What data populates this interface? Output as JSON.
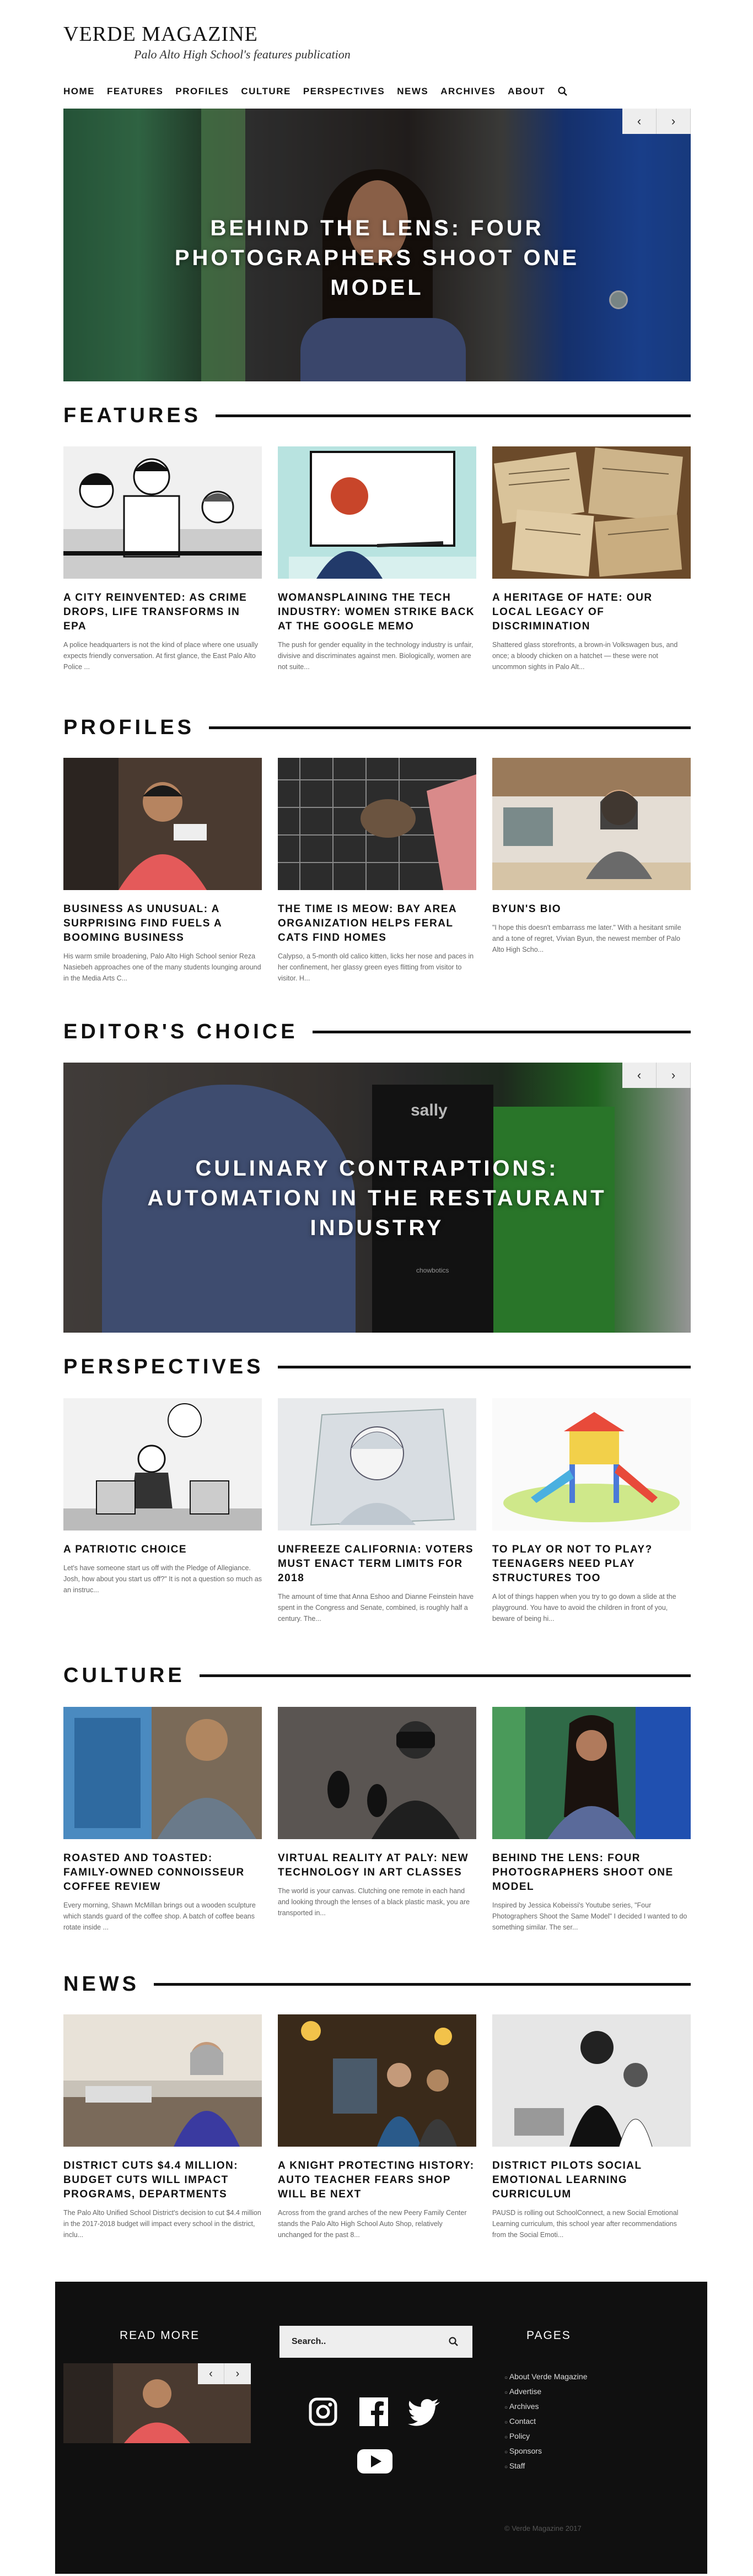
{
  "site": {
    "title": "VERDE MAGAZINE",
    "subtitle": "Palo Alto High School's features publication"
  },
  "nav": [
    "HOME",
    "FEATURES",
    "PROFILES",
    "CULTURE",
    "PERSPECTIVES",
    "NEWS",
    "ARCHIVES",
    "ABOUT"
  ],
  "hero": {
    "title": "BEHIND THE LENS: FOUR PHOTOGRAPHERS SHOOT ONE MODEL",
    "prev": "‹",
    "next": "›"
  },
  "sections": {
    "features": {
      "heading": "FEATURES",
      "cards": [
        {
          "title": "A CITY REINVENTED: AS CRIME DROPS, LIFE TRANSFORMS IN EPA",
          "excerpt": "A police headquarters is not the kind of place where one usually expects friendly conversation. At first glance, the East Palo Alto Police ..."
        },
        {
          "title": "WOMANSPLAINING THE TECH INDUSTRY: WOMEN STRIKE BACK AT THE GOOGLE MEMO",
          "excerpt": "The push for gender equality in the technology industry is unfair, divisive and discriminates against men. Biologically, women are not suite..."
        },
        {
          "title": "A HERITAGE OF HATE: OUR LOCAL LEGACY OF DISCRIMINATION",
          "excerpt": "Shattered glass storefronts, a brown-in Volkswagen bus, and once; a bloody chicken on a hatchet — these were not uncommon sights in Palo Alt..."
        }
      ]
    },
    "profiles": {
      "heading": "PROFILES",
      "cards": [
        {
          "title": "BUSINESS AS UNUSUAL: A SURPRISING FIND FUELS A BOOMING BUSINESS",
          "excerpt": "His warm smile broadening, Palo Alto High School senior Reza Nasiebeh approaches one of the many students lounging around in the Media Arts C..."
        },
        {
          "title": "THE TIME IS MEOW: BAY AREA ORGANIZATION HELPS FERAL CATS FIND HOMES",
          "excerpt": "Calypso, a 5-month old calico kitten, licks her nose and paces in her confinement, her glassy green eyes flitting from visitor to visitor. H..."
        },
        {
          "title": "BYUN'S BIO",
          "excerpt": "\"I hope this doesn't embarrass me later.\" With a hesitant smile and a tone of regret, Vivian Byun, the newest member of Palo Alto High Scho..."
        }
      ]
    },
    "editors": {
      "heading": "EDITOR'S CHOICE",
      "slide_title": "CULINARY CONTRAPTIONS: AUTOMATION IN THE RESTAURANT INDUSTRY",
      "sign": "sally",
      "sign2": "chowbotics"
    },
    "perspectives": {
      "heading": "PERSPECTIVES",
      "cards": [
        {
          "title": "A PATRIOTIC CHOICE",
          "excerpt": "Let's have someone start us off with the Pledge of Allegiance. Josh, how about you start us off?\" It is not a question so much as an instruc..."
        },
        {
          "title": "UNFREEZE CALIFORNIA: VOTERS MUST ENACT TERM LIMITS FOR 2018",
          "excerpt": "The amount of time that Anna Eshoo and Dianne Feinstein have spent in the Congress and Senate, combined, is roughly half a century. The..."
        },
        {
          "title": "TO PLAY OR NOT TO PLAY? TEENAGERS NEED PLAY STRUCTURES TOO",
          "excerpt": "A lot of things happen when you try to go down a slide at the playground. You have to avoid the children in front of you, beware of being hi..."
        }
      ]
    },
    "culture": {
      "heading": "CULTURE",
      "cards": [
        {
          "title": "ROASTED AND TOASTED: FAMILY-OWNED CONNOISSEUR COFFEE REVIEW",
          "excerpt": "Every morning, Shawn McMillan brings out a wooden sculpture which stands guard of the coffee shop. A batch of coffee beans rotate inside ..."
        },
        {
          "title": "VIRTUAL REALITY AT PALY: NEW TECHNOLOGY IN ART CLASSES",
          "excerpt": "The world is your canvas. Clutching one remote in each hand and looking through the lenses of a black plastic mask, you are transported in..."
        },
        {
          "title": "BEHIND THE LENS: FOUR PHOTOGRAPHERS SHOOT ONE MODEL",
          "excerpt": "Inspired by Jessica Kobeissi's Youtube series, \"Four Photographers Shoot the Same Model\" I decided I wanted to do something similar. The ser..."
        }
      ]
    },
    "news": {
      "heading": "NEWS",
      "cards": [
        {
          "title": "DISTRICT CUTS $4.4 MILLION: BUDGET CUTS WILL IMPACT PROGRAMS, DEPARTMENTS",
          "excerpt": "The Palo Alto Unified School District's decision to cut $4.4 million in the 2017-2018 budget will impact every school in the district, inclu..."
        },
        {
          "title": "A KNIGHT PROTECTING HISTORY: AUTO TEACHER FEARS SHOP WILL BE NEXT",
          "excerpt": "Across from the grand arches of the new Peery Family Center stands the Palo Alto High School Auto Shop, relatively unchanged for the past 8..."
        },
        {
          "title": "DISTRICT PILOTS SOCIAL EMOTIONAL LEARNING CURRICULUM",
          "excerpt": "PAUSD is rolling out SchoolConnect, a new Social Emotional Learning curriculum, this school year after recommendations from the Social Emoti..."
        }
      ]
    }
  },
  "footer": {
    "read_more": "READ MORE",
    "search_placeholder": "Search..",
    "pages_heading": "PAGES",
    "pages": [
      "About Verde Magazine",
      "Advertise",
      "Archives",
      "Contact",
      "Policy",
      "Sponsors",
      "Staff"
    ],
    "copyright": "© Verde Magazine 2017",
    "prev": "‹",
    "next": "›"
  },
  "icons": [
    "search-icon",
    "instagram-icon",
    "facebook-icon",
    "twitter-icon",
    "youtube-icon"
  ]
}
